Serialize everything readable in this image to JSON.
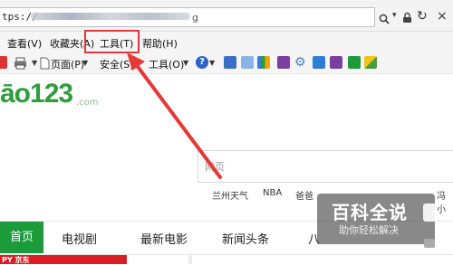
{
  "address_bar": {
    "url_prefix": "tps://",
    "url_suffix": "g"
  },
  "menu": {
    "view": "查看(V)",
    "favorites": "收藏夹(A)",
    "tools": "工具(T)",
    "help": "帮助(H)"
  },
  "command_bar": {
    "page": "页面(P)",
    "safety": "安全(S)",
    "tools": "工具(O)"
  },
  "page": {
    "logo": "āo123",
    "logo_suffix": ".com",
    "search_tab": "网页",
    "quick_links": [
      "兰州天气",
      "NBA",
      "爸爸",
      "冯小"
    ],
    "nav": [
      "首页",
      "电视剧",
      "最新电影",
      "新闻头条",
      "八"
    ],
    "bottom_banner": "PY 京东"
  },
  "watermark": {
    "title": "百科全说",
    "subtitle": "助你轻松解决"
  },
  "colors": {
    "accent_red": "#e53935",
    "logo_green": "#2e9d3b",
    "nav_green": "#1b9b3a"
  }
}
